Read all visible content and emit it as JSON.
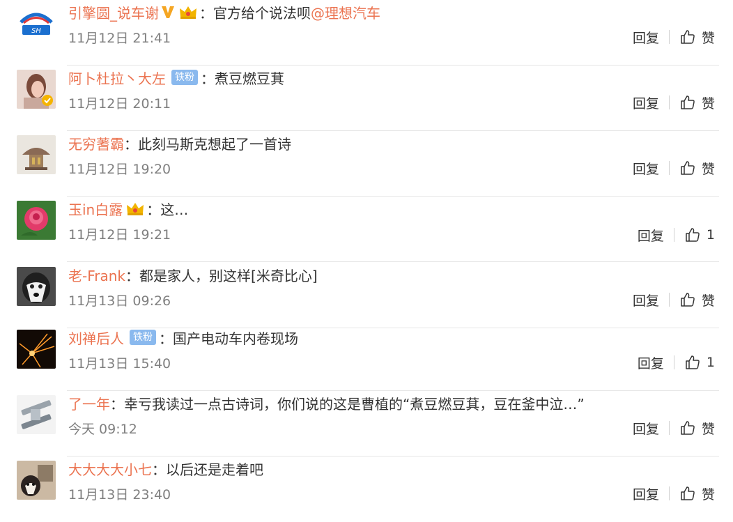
{
  "comments": [
    {
      "avatar": "lane-logo-avatar",
      "username": "引擎圆_说车谢",
      "badges": [
        "vip-v",
        "crown"
      ],
      "text": "官方给个说法呗",
      "mention": "@理想汽车",
      "time": "11月12日 21:41",
      "reply_label": "回复",
      "like_label": "赞"
    },
    {
      "avatar": "girl-photo-avatar",
      "username": "阿卜杜拉丶大左",
      "badges": [
        "iron-fan"
      ],
      "text": "煮豆燃豆萁",
      "time": "11月12日 20:11",
      "reply_label": "回复",
      "like_label": "赞"
    },
    {
      "avatar": "pagoda-avatar",
      "username": "无穷蓍霸",
      "badges": [],
      "text": "此刻马斯克想起了一首诗",
      "time": "11月12日 19:20",
      "reply_label": "回复",
      "like_label": "赞"
    },
    {
      "avatar": "rose-avatar",
      "username": "玉in白露",
      "badges": [
        "crown"
      ],
      "text": "这…",
      "time": "11月12日 19:21",
      "reply_label": "回复",
      "like_label": "1"
    },
    {
      "avatar": "husky-avatar",
      "username": "老-Frank",
      "badges": [],
      "text": "都是家人，别这样[米奇比心]",
      "time": "11月13日 09:26",
      "reply_label": "回复",
      "like_label": "赞"
    },
    {
      "avatar": "sparks-avatar",
      "username": "刘禅后人",
      "badges": [
        "iron-fan"
      ],
      "text": "国产电动车内卷现场",
      "time": "11月13日 15:40",
      "reply_label": "回复",
      "like_label": "1"
    },
    {
      "avatar": "hardware-avatar",
      "username": "了一年",
      "badges": [],
      "text": "幸亏我读过一点古诗词，你们说的这是曹植的“煮豆燃豆萁，豆在釜中泣…”",
      "time": "今天 09:12",
      "reply_label": "回复",
      "like_label": "赞"
    },
    {
      "avatar": "dog-avatar",
      "username": "大大大大小七",
      "badges": [],
      "text": "以后还是走着吧",
      "time": "11月13日 23:40",
      "reply_label": "回复",
      "like_label": "赞"
    }
  ],
  "badge_text": {
    "iron-fan": "铁粉"
  },
  "colors": {
    "username": "#eb7350",
    "text": "#333333",
    "time": "#808080",
    "divider": "#e6e6e6",
    "iron_badge": "#8ab9ee",
    "vip_v": "#f5a623"
  }
}
